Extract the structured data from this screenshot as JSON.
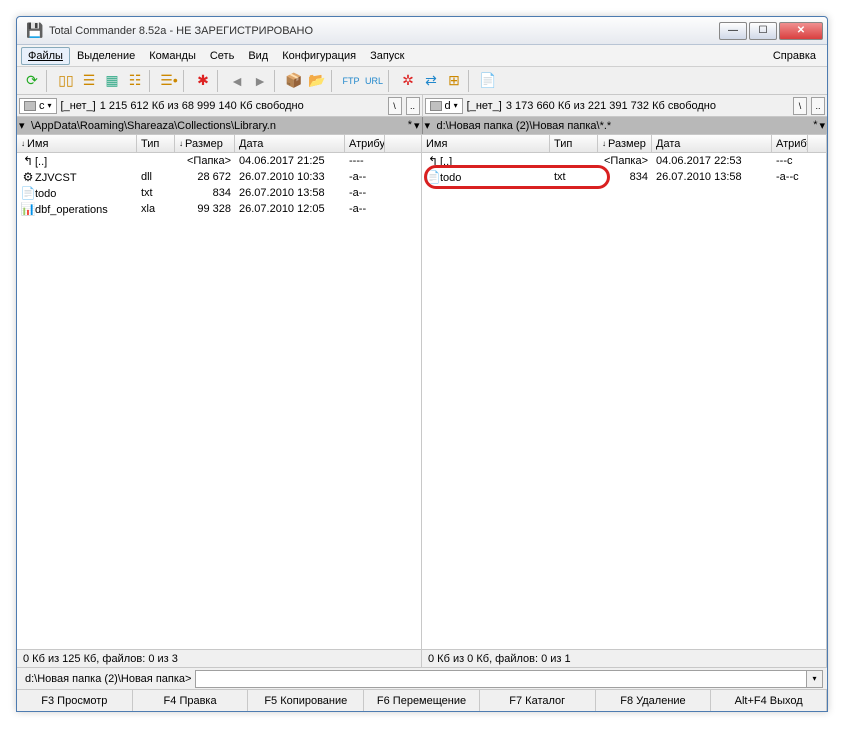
{
  "title": "Total Commander 8.52a - НЕ ЗАРЕГИСТРИРОВАНО",
  "menu": {
    "file": "Файлы",
    "sel": "Выделение",
    "cmd": "Команды",
    "net": "Сеть",
    "view": "Вид",
    "cfg": "Конфигурация",
    "run": "Запуск",
    "help": "Справка"
  },
  "drives": {
    "left": {
      "letter": "c",
      "none": "[_нет_]",
      "info": "1 215 612 Кб из 68 999 140 Кб свободно"
    },
    "right": {
      "letter": "d",
      "none": "[_нет_]",
      "info": "3 173 660 Кб из 221 391 732 Кб свободно"
    }
  },
  "paths": {
    "left": "\\AppData\\Roaming\\Shareaza\\Collections\\Library.n",
    "right": "d:\\Новая папка (2)\\Новая папка\\*.*"
  },
  "cols": {
    "name": "Имя",
    "ext": "Тип",
    "size": "Размер",
    "date": "Дата",
    "attr": "Атрибу"
  },
  "left_rows": [
    {
      "icon": "↰",
      "name": "[..]",
      "ext": "",
      "size": "<Папка>",
      "date": "04.06.2017 21:25",
      "attr": "----"
    },
    {
      "icon": "⚙",
      "name": "ZJVCST",
      "ext": "dll",
      "size": "28 672",
      "date": "26.07.2010 10:33",
      "attr": "-a--"
    },
    {
      "icon": "📄",
      "name": "todo",
      "ext": "txt",
      "size": "834",
      "date": "26.07.2010 13:58",
      "attr": "-a--"
    },
    {
      "icon": "📊",
      "name": "dbf_operations",
      "ext": "xla",
      "size": "99 328",
      "date": "26.07.2010 12:05",
      "attr": "-a--"
    }
  ],
  "right_rows": [
    {
      "icon": "↰",
      "name": "[..]",
      "ext": "",
      "size": "<Папка>",
      "date": "04.06.2017 22:53",
      "attr": "---c"
    },
    {
      "icon": "📄",
      "name": "todo",
      "ext": "txt",
      "size": "834",
      "date": "26.07.2010 13:58",
      "attr": "-a--c"
    }
  ],
  "status": {
    "left": "0 Кб из 125 Кб, файлов: 0 из 3",
    "right": "0 Кб из 0 Кб, файлов: 0 из 1"
  },
  "cmd": {
    "prompt": "d:\\Новая папка (2)\\Новая папка>"
  },
  "fkeys": {
    "f3": "F3 Просмотр",
    "f4": "F4 Правка",
    "f5": "F5 Копирование",
    "f6": "F6 Перемещение",
    "f7": "F7 Каталог",
    "f8": "F8 Удаление",
    "altf4": "Alt+F4 Выход"
  }
}
